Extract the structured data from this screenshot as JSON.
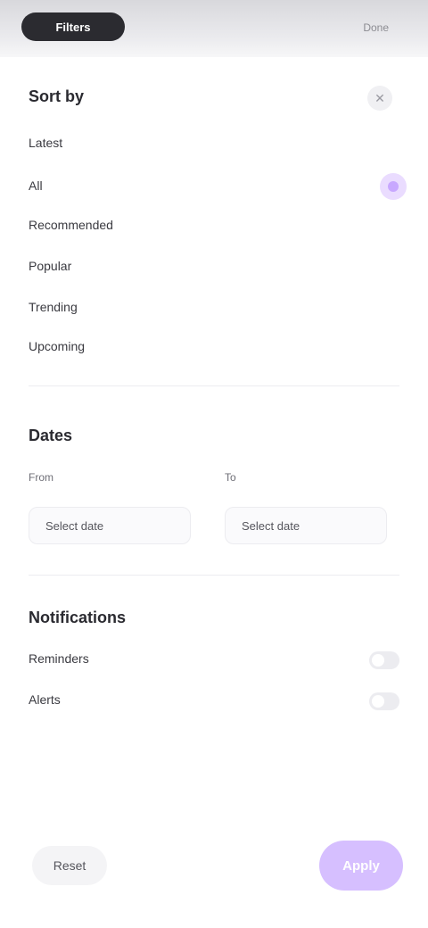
{
  "topbar": {
    "title": "Filters",
    "status": "Done"
  },
  "sort": {
    "title": "Sort by",
    "items": [
      {
        "label": "Latest"
      },
      {
        "label": "All"
      },
      {
        "label": "Recommended"
      },
      {
        "label": "Popular"
      },
      {
        "label": "Trending"
      },
      {
        "label": "Upcoming"
      }
    ]
  },
  "dates": {
    "title": "Dates",
    "start_label": "From",
    "end_label": "To",
    "start_value": "Select date",
    "end_value": "Select date"
  },
  "notifications": {
    "title": "Notifications",
    "items": [
      {
        "label": "Reminders"
      },
      {
        "label": "Alerts"
      }
    ]
  },
  "actions": {
    "reset": "Reset",
    "apply": "Apply"
  },
  "colors": {
    "accent": "#d6bfff",
    "accent_dot": "#c8a8ff"
  }
}
